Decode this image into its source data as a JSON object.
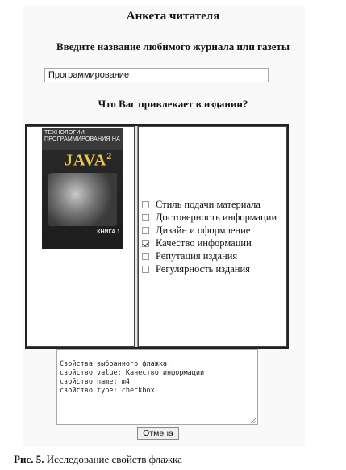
{
  "form": {
    "title": "Анкета читателя",
    "magazine_prompt": "Введите название любимого журнала или газеты",
    "magazine_value": "Программирование",
    "question": "Что Вас привлекает в издании?"
  },
  "book": {
    "top_text": "ТЕХНОЛОГИИ ПРОГРАММИРОВАНИЯ НА",
    "java": "JAVA",
    "java_version": "2",
    "volume": "КНИГА 1"
  },
  "options": [
    {
      "label": "Стиль подачи материала",
      "checked": false
    },
    {
      "label": "Достоверность информации",
      "checked": false
    },
    {
      "label": "Дизайн и оформление",
      "checked": false
    },
    {
      "label": "Качество информации",
      "checked": true
    },
    {
      "label": "Репутация издания",
      "checked": false
    },
    {
      "label": "Регулярность издания",
      "checked": false
    }
  ],
  "console": {
    "lines": [
      "Свойства выбранного флажка:",
      "свойство value: Качество информации",
      "свойство name: m4",
      "свойство type: checkbox"
    ]
  },
  "buttons": {
    "cancel": "Отмена"
  },
  "caption": {
    "prefix": "Рис. 5.",
    "text": "Исследование свойств флажка"
  }
}
